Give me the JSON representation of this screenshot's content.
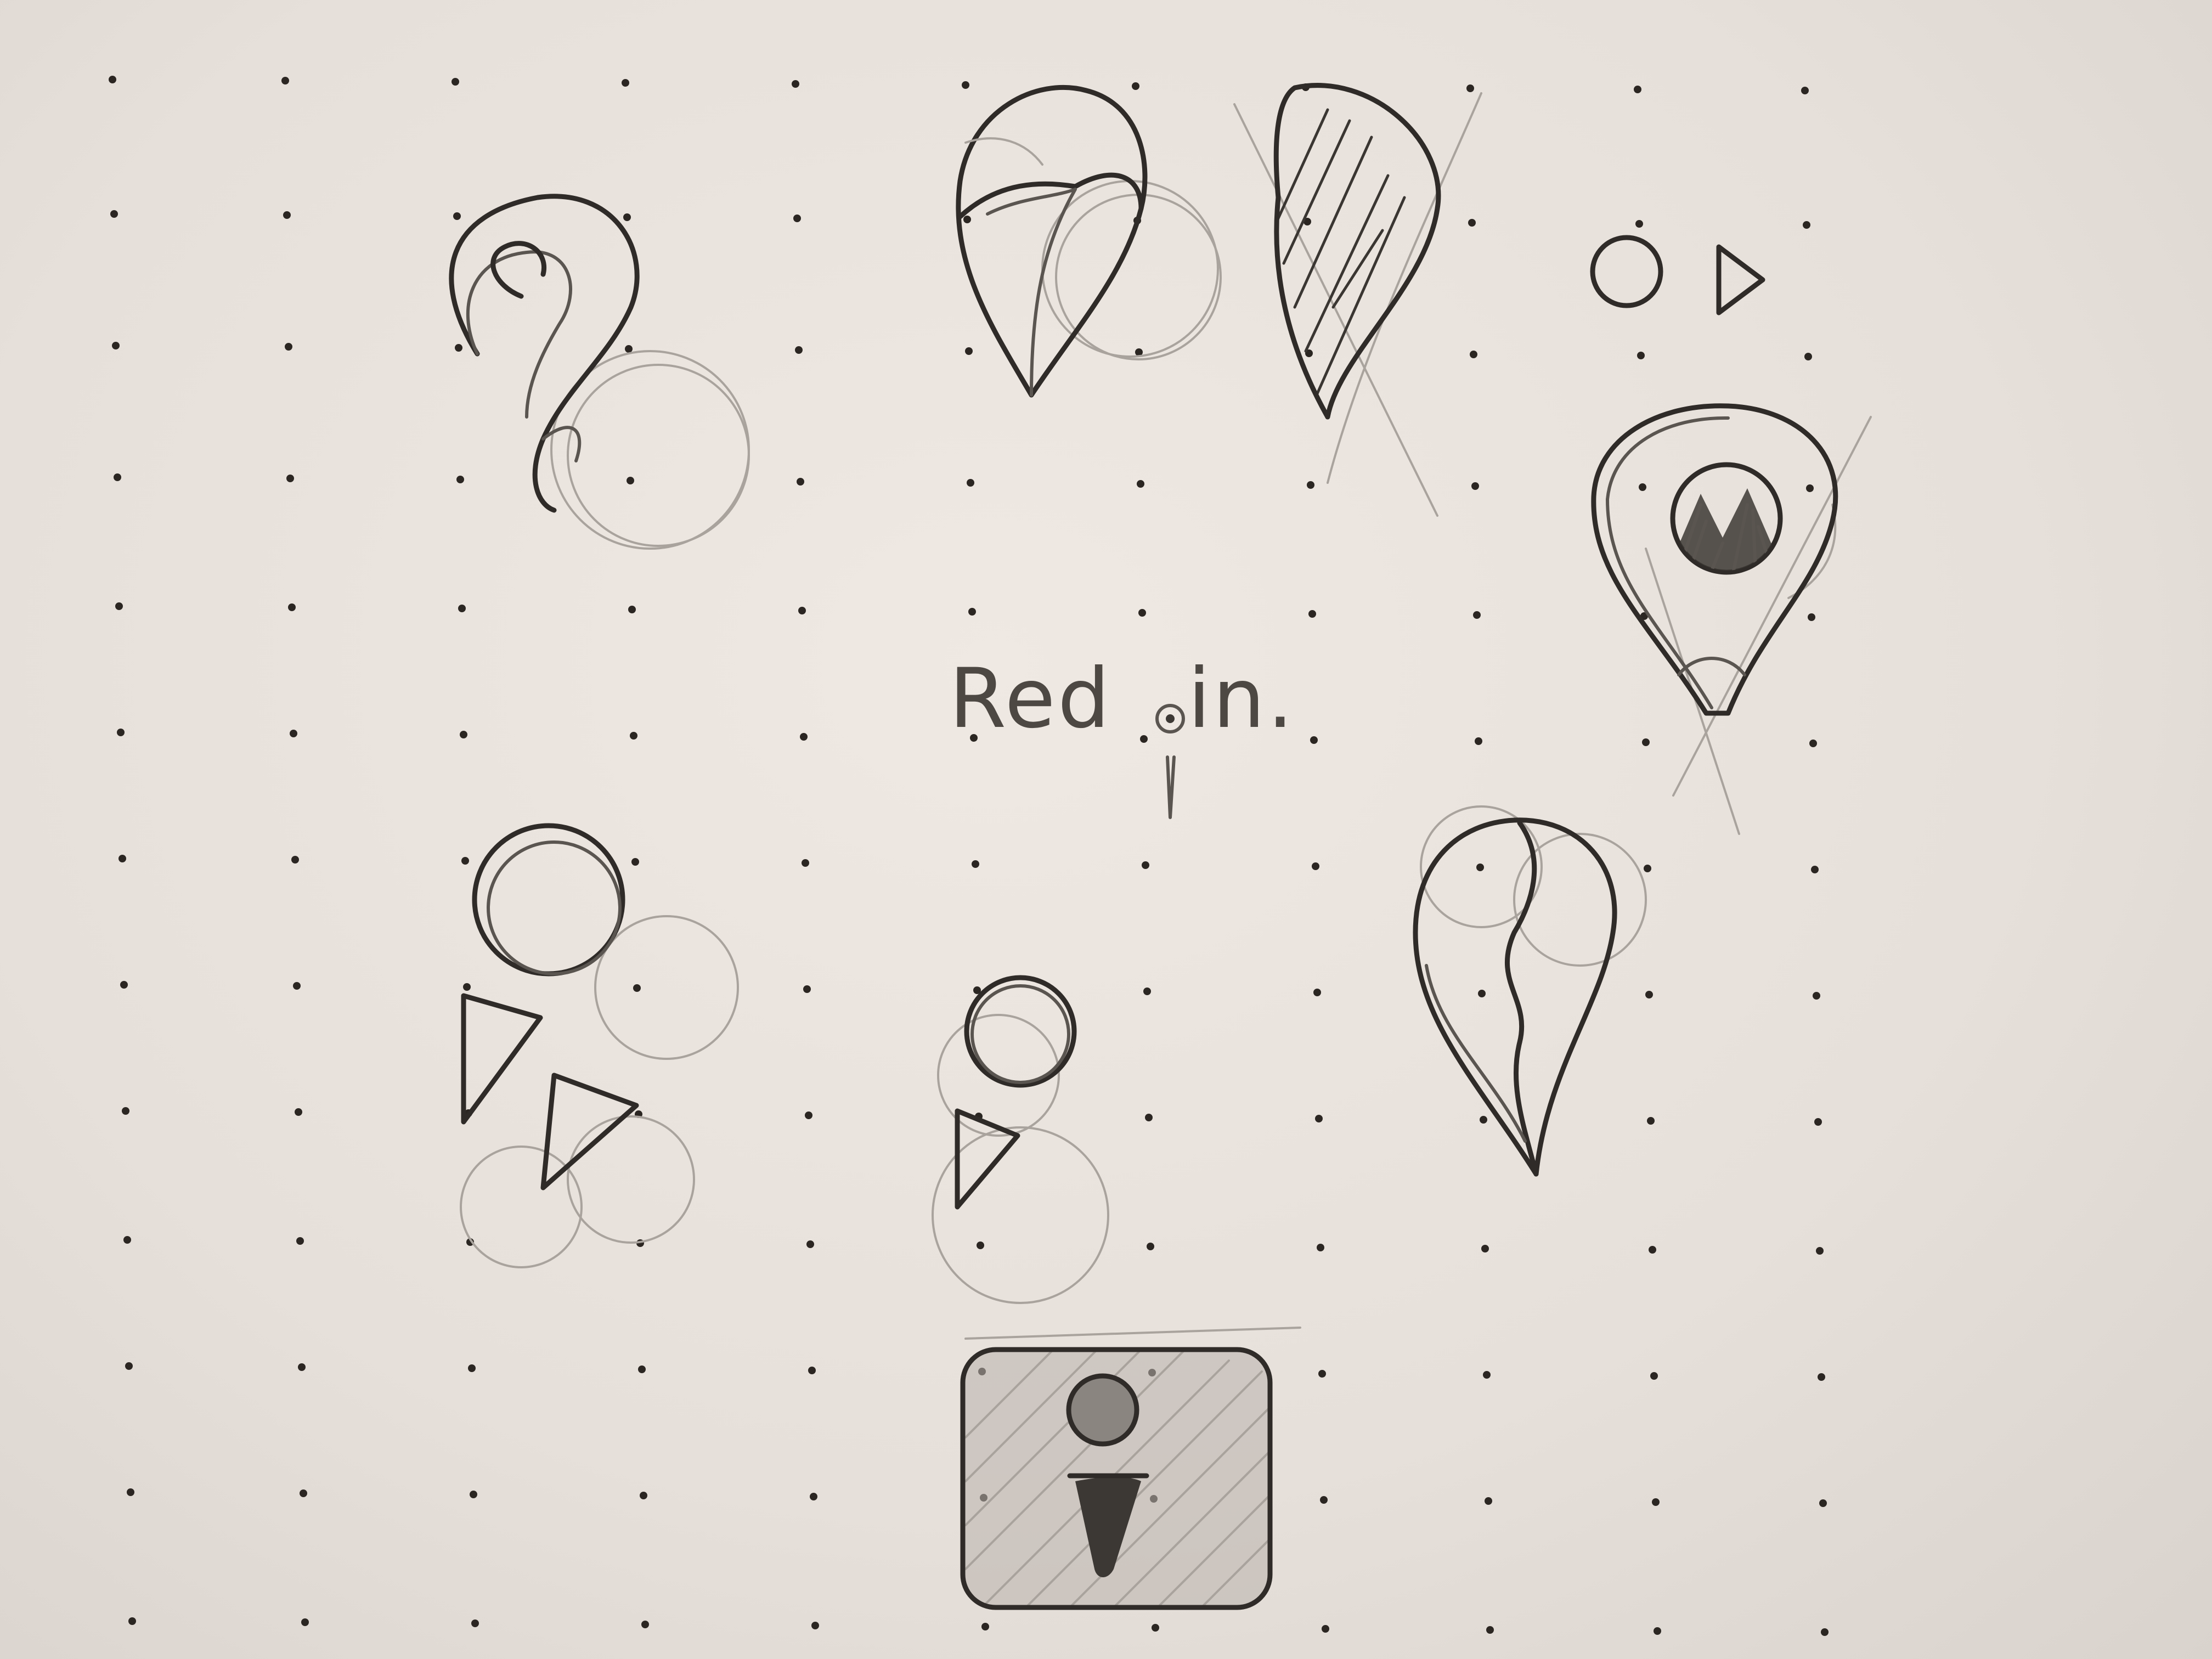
{
  "sketch": {
    "wordmark": {
      "part1": "Red",
      "part2": "in."
    },
    "icons": [
      "hook-swirl-pin-icon",
      "split-teardrop-pin-icon",
      "hatched-teardrop-pin-icon",
      "circle-play-icon",
      "mountain-map-pin-icon",
      "double-circle-play-icon",
      "single-circle-play-icon",
      "wave-split-pin-icon",
      "person-badge-icon"
    ],
    "colors": {
      "paper": "#e9e3dd",
      "graphite": "#3c3834",
      "dots": "#2b2622"
    }
  }
}
